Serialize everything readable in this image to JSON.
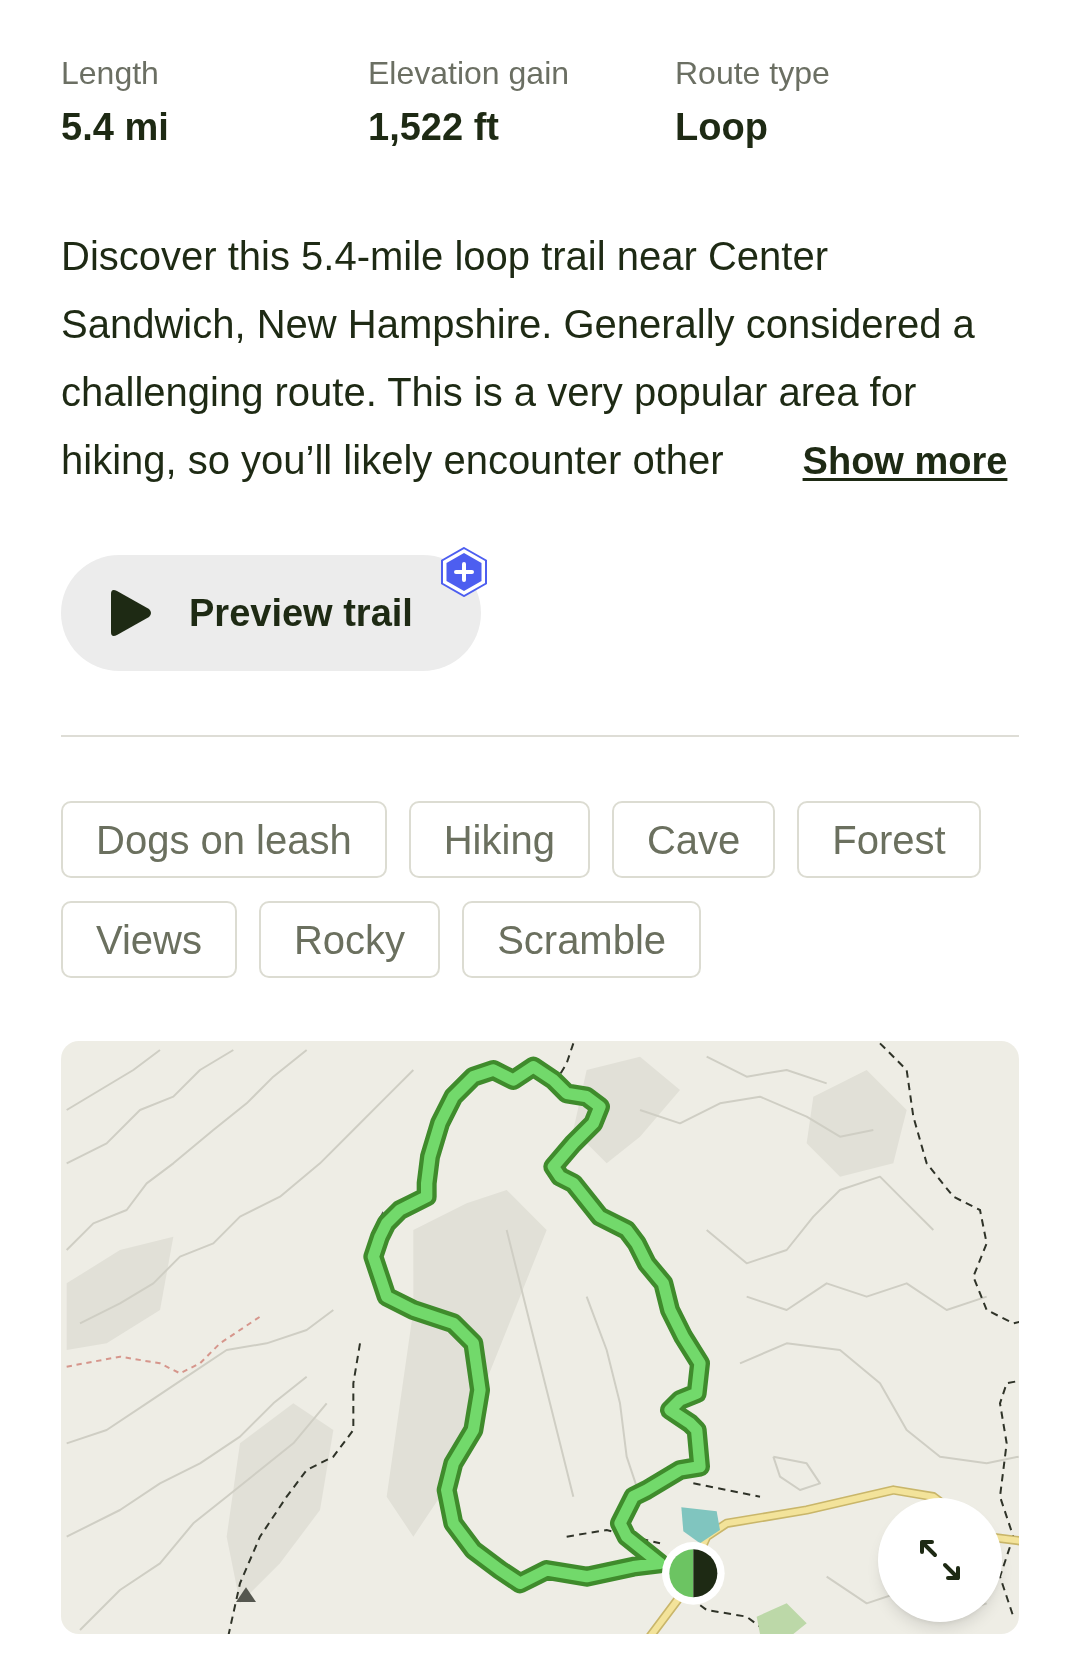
{
  "stats": [
    {
      "label": "Length",
      "value": "5.4 mi"
    },
    {
      "label": "Elevation gain",
      "value": "1,522 ft"
    },
    {
      "label": "Route type",
      "value": "Loop"
    }
  ],
  "description": {
    "text": "Discover this 5.4-mile loop trail near Center Sandwich, New Hampshire. Generally considered a challenging route. This is a very popular area for hiking, so you’ll likely encounter other",
    "link": "Show more"
  },
  "preview_button": {
    "label": "Preview trail"
  },
  "tags": [
    "Dogs on leash",
    "Hiking",
    "Cave",
    "Forest",
    "Views",
    "Rocky",
    "Scramble"
  ]
}
